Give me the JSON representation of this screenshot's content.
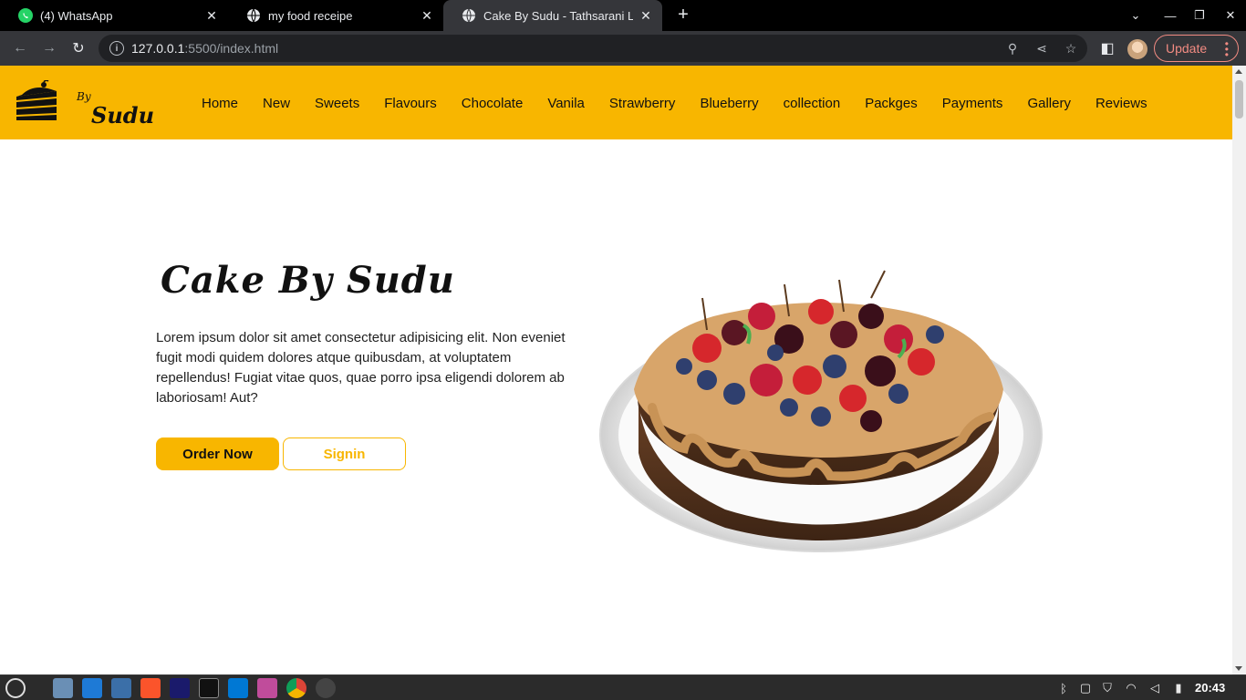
{
  "browser": {
    "tabs": [
      {
        "title": "(4) WhatsApp",
        "icon": "whatsapp-icon",
        "active": false
      },
      {
        "title": "my food receipe",
        "icon": "globe-icon",
        "active": false
      },
      {
        "title": "Cake By Sudu - Tathsarani Liya",
        "icon": "globe-icon",
        "active": true
      }
    ],
    "url_host": "127.0.0.1",
    "url_rest": ":5500/index.html",
    "update_label": "Update"
  },
  "site": {
    "logo_by": "By",
    "logo_name": "Sudu",
    "nav": [
      "Home",
      "New",
      "Sweets",
      "Flavours",
      "Chocolate",
      "Vanila",
      "Strawberry",
      "Blueberry",
      "collection",
      "Packges",
      "Payments",
      "Gallery",
      "Reviews"
    ],
    "hero": {
      "title": "Cake By Sudu",
      "text": "Lorem ipsum dolor sit amet consectetur adipisicing elit. Non eveniet fugit modi quidem dolores atque quibusdam, at voluptatem repellendus! Fugiat vitae quos, quae porro ipsa eligendi dolorem ab laboriosam! Aut?",
      "order_label": "Order Now",
      "signin_label": "Signin"
    },
    "colors": {
      "brand": "#f8b600",
      "text": "#111111"
    }
  },
  "taskbar": {
    "clock": "20:43"
  }
}
